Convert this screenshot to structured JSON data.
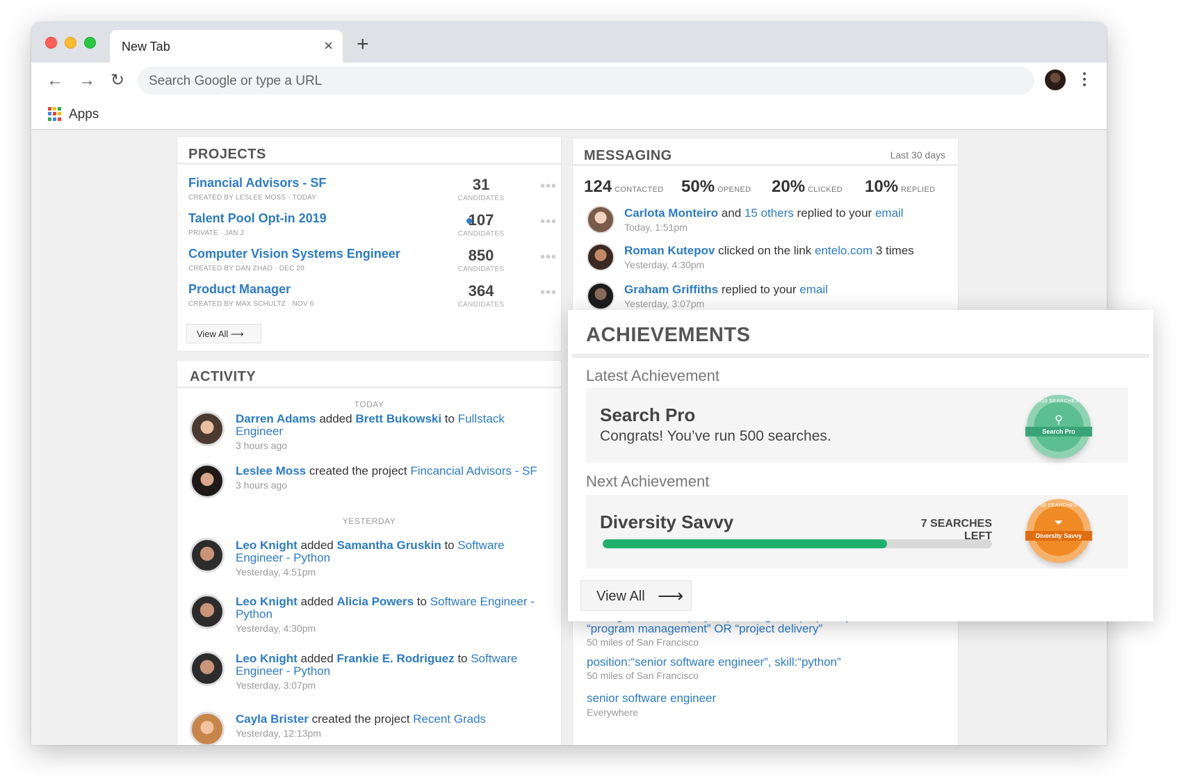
{
  "browser": {
    "tab_title": "New Tab",
    "tab_close": "×",
    "new_tab": "+",
    "back": "←",
    "forward": "→",
    "reload": "↻",
    "omnibox_placeholder": "Search Google or type a URL",
    "bookmarks_apps": "Apps"
  },
  "projects": {
    "title": "PROJECTS",
    "candidates_label": "CANDIDATES",
    "more": "•••",
    "items": [
      {
        "name": "Financial Advisors - SF",
        "meta": "CREATED BY LESLEE MOSS · TODAY",
        "count": "31"
      },
      {
        "name": "Talent Pool Opt-in 2019",
        "meta": "PRIVATE · JAN 2",
        "count": "107"
      },
      {
        "name": "Computer Vision Systems Engineer",
        "meta": "CREATED BY DAN ZHAO · DEC 20",
        "count": "850"
      },
      {
        "name": "Product Manager",
        "meta": "CREATED BY MAX SCHULTZ · NOV 6",
        "count": "364"
      }
    ],
    "view_all": "View All ⟶"
  },
  "activity": {
    "title": "ACTIVITY",
    "today": "TODAY",
    "yesterday": "YESTERDAY",
    "items": [
      {
        "actor": "Darren Adams",
        "verb": " added ",
        "object": "Brett Bukowski",
        "prep": " to ",
        "target": "Fullstack Engineer",
        "time": "3 hours ago"
      },
      {
        "actor": "Leslee Moss",
        "verb": " created the project ",
        "object": "",
        "prep": "",
        "target": "Fincancial Advisors - SF",
        "time": "3 hours ago"
      },
      {
        "actor": "Leo Knight",
        "verb": " added ",
        "object": "Samantha Gruskin",
        "prep": " to ",
        "target": "Software Engineer - Python",
        "time": "Yesterday, 4:51pm"
      },
      {
        "actor": "Leo Knight",
        "verb": " added ",
        "object": "Alicia Powers",
        "prep": " to ",
        "target": "Software Engineer - Python",
        "time": "Yesterday, 4:30pm"
      },
      {
        "actor": "Leo Knight",
        "verb": " added ",
        "object": "Frankie E. Rodriguez",
        "prep": " to ",
        "target": "Software Engineer - Python",
        "time": "Yesterday, 3:07pm"
      },
      {
        "actor": "Cayla Brister",
        "verb": " created the project ",
        "object": "",
        "prep": "",
        "target": "Recent Grads",
        "time": "Yesterday, 12:13pm"
      }
    ]
  },
  "messaging": {
    "title": "MESSAGING",
    "period": "Last 30 days",
    "stats": [
      {
        "value": "124",
        "label": "CONTACTED"
      },
      {
        "value": "50%",
        "label": "OPENED"
      },
      {
        "value": "20%",
        "label": "CLICKED"
      },
      {
        "value": "10%",
        "label": "REPLIED"
      }
    ],
    "items": [
      {
        "actor": "Carlota Monteiro",
        "mid1": " and ",
        "link1": "15 others",
        "mid2": " replied to your ",
        "link2": "email",
        "tail": "",
        "time": "Today, 1:51pm"
      },
      {
        "actor": "Roman Kutepov",
        "mid1": " clicked on the link ",
        "link1": "entelo.com",
        "mid2": " 3 times",
        "link2": "",
        "tail": "",
        "time": "Yesterday, 4:30pm"
      },
      {
        "actor": "Graham Griffiths",
        "mid1": " replied to your ",
        "link1": "email",
        "mid2": "",
        "link2": "",
        "tail": "",
        "time": "Yesterday, 3:07pm"
      }
    ]
  },
  "searches": {
    "items": [
      {
        "query": "position:(“project manager” OR “program manager”) “project management” OR “project planning” OR pmp PR pmo OR “program management” OR “project delivery”",
        "location": "50 miles of San Francisco"
      },
      {
        "query": "position:“senior software engineer”, skill:“python”",
        "location": "50 miles of San Francisco"
      },
      {
        "query": "senior software engineer",
        "location": "Everywhere"
      }
    ]
  },
  "achievements": {
    "title": "ACHIEVEMENTS",
    "latest_label": "Latest Achievement",
    "latest_name": "Search Pro",
    "latest_desc": "Congrats! You’ve run 500 searches.",
    "latest_badge_top": "500 SEARCHES",
    "latest_badge_ribbon": "Search Pro",
    "next_label": "Next Achievement",
    "next_name": "Diversity Savvy",
    "next_remaining": "7 SEARCHES LEFT",
    "next_progress_percent": 73,
    "next_badge_top": "50 SEARCHES",
    "next_badge_ribbon": "Diversity Savvy",
    "view_all": "View All",
    "view_all_arrow": "⟶",
    "colors": {
      "progress": "#1fb06e",
      "badge_green": "#5cbf93",
      "badge_orange": "#f08a24"
    }
  },
  "colors": {
    "link": "#2b7bc6"
  }
}
